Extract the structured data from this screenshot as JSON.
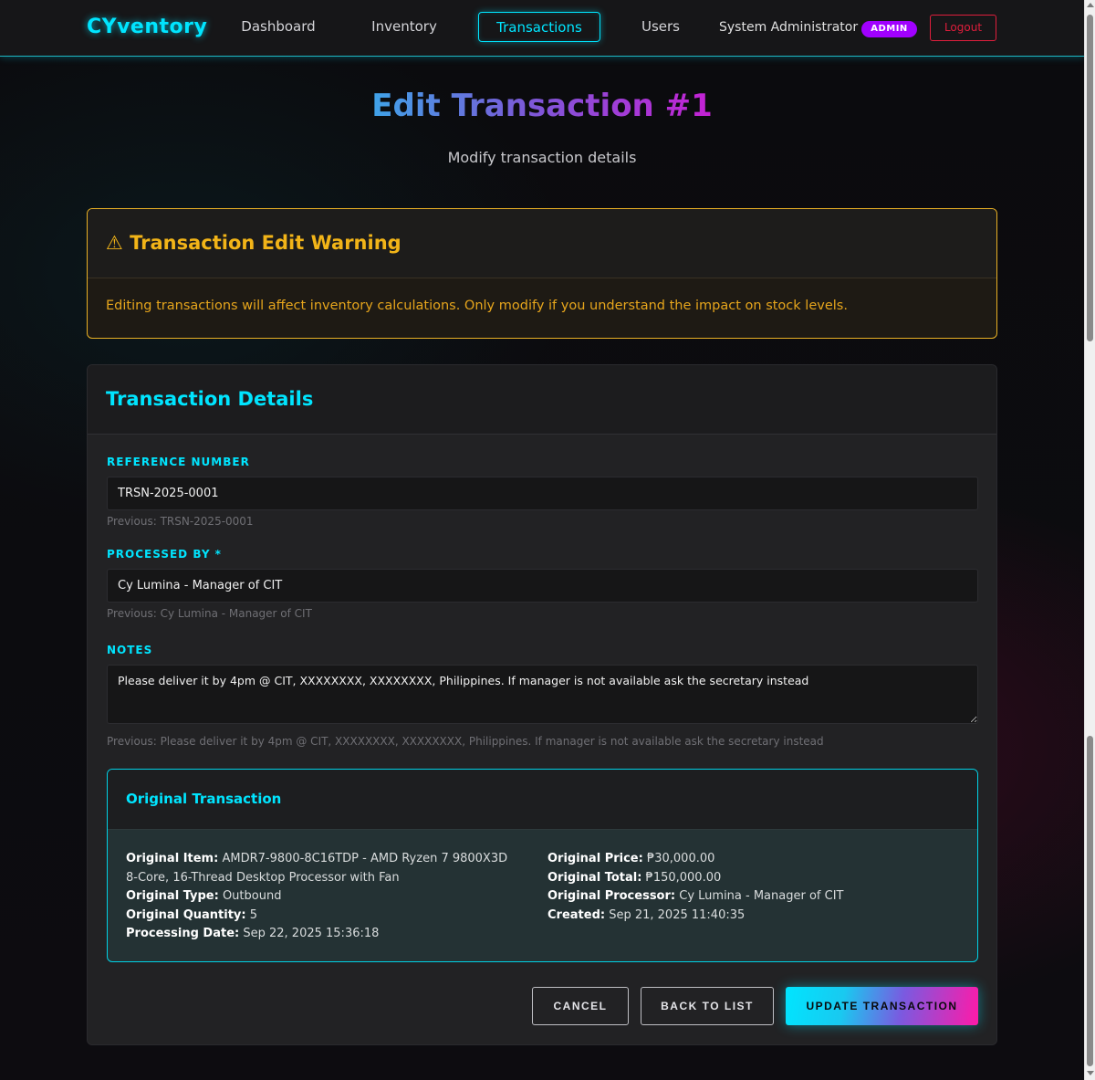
{
  "nav": {
    "brand": "CYventory",
    "links": [
      "Dashboard",
      "Inventory",
      "Transactions",
      "Users"
    ],
    "active": "Transactions",
    "user_name": "System Administrator",
    "role_badge": "ADMIN",
    "logout_label": "Logout"
  },
  "page": {
    "title": "Edit Transaction #1",
    "subtitle": "Modify transaction details"
  },
  "warning": {
    "icon": "warning-triangle-icon",
    "title": "⚠ Transaction Edit Warning",
    "message": "Editing transactions will affect inventory calculations. Only modify if you understand the impact on stock levels."
  },
  "form": {
    "heading": "Transaction Details",
    "reference": {
      "label": "REFERENCE NUMBER",
      "value": "TRSN-2025-0001",
      "previous": "Previous: TRSN-2025-0001"
    },
    "processed_by": {
      "label": "PROCESSED BY *",
      "value": "Cy Lumina - Manager of CIT",
      "previous": "Previous: Cy Lumina - Manager of CIT"
    },
    "notes": {
      "label": "NOTES",
      "value": "Please deliver it by 4pm @ CIT, XXXXXXXX, XXXXXXXX, Philippines. If manager is not available ask the secretary instead",
      "previous": "Previous: Please deliver it by 4pm @ CIT, XXXXXXXX, XXXXXXXX, Philippines. If manager is not available ask the secretary instead"
    }
  },
  "original": {
    "heading": "Original Transaction",
    "item_label": "Original Item:",
    "item_value": "AMDR7-9800-8C16TDP - AMD Ryzen 7 9800X3D 8-Core, 16-Thread Desktop Processor with Fan",
    "type_label": "Original Type:",
    "type_value": "Outbound",
    "qty_label": "Original Quantity:",
    "qty_value": "5",
    "date_label": "Processing Date:",
    "date_value": "Sep 22, 2025 15:36:18",
    "price_label": "Original Price:",
    "price_value": "₱30,000.00",
    "total_label": "Original Total:",
    "total_value": "₱150,000.00",
    "processor_label": "Original Processor:",
    "processor_value": "Cy Lumina - Manager of CIT",
    "created_label": "Created:",
    "created_value": "Sep 21, 2025 11:40:35"
  },
  "actions": {
    "cancel": "CANCEL",
    "back": "BACK TO LIST",
    "update": "UPDATE TRANSACTION"
  },
  "colors": {
    "accent_cyan": "#00e5ff",
    "accent_magenta": "#ff1aa8",
    "warning": "#f2b418",
    "danger": "#e01e3c",
    "badge": "#a100ff"
  }
}
